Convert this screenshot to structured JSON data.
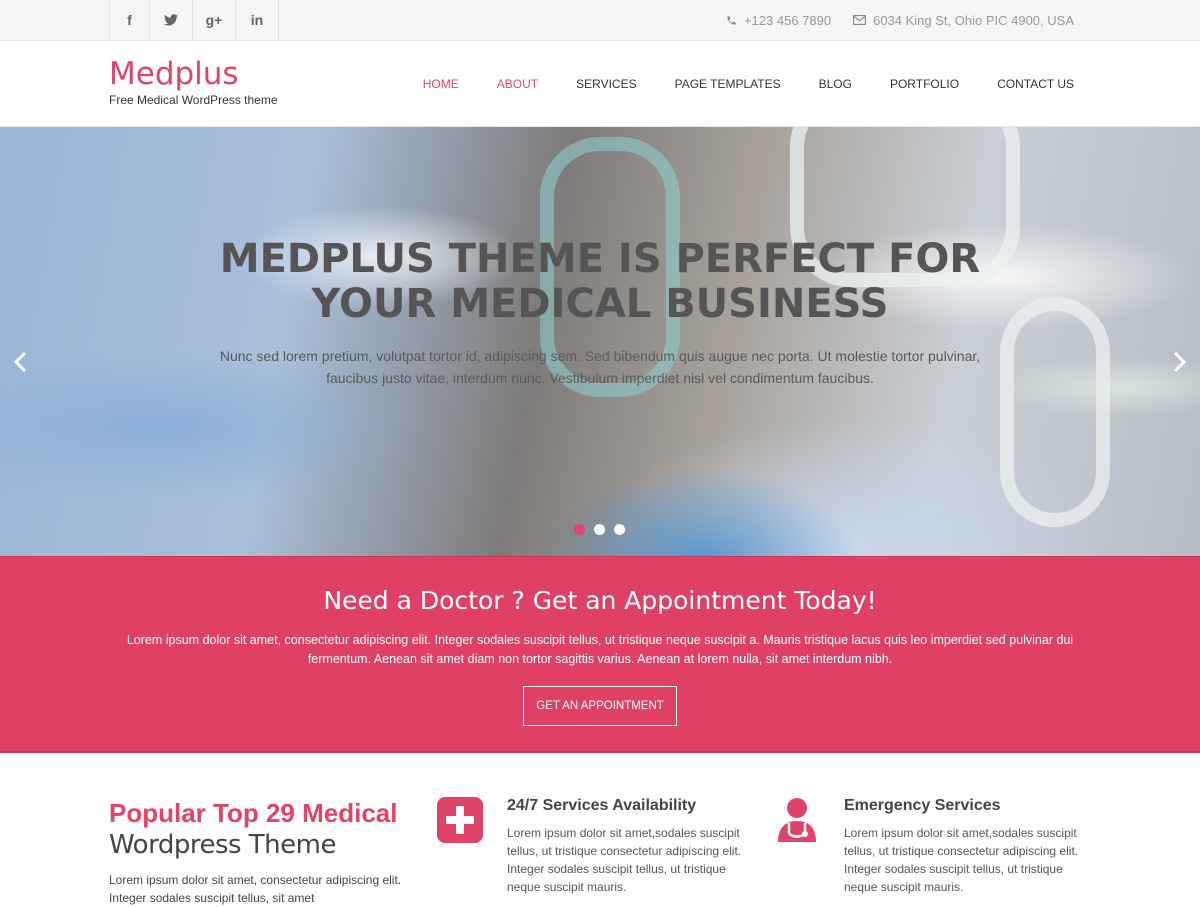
{
  "topbar": {
    "social": [
      {
        "icon": "facebook-icon",
        "glyph": "f"
      },
      {
        "icon": "twitter-icon",
        "glyph": "t"
      },
      {
        "icon": "google-plus-icon",
        "glyph": "g+"
      },
      {
        "icon": "linkedin-icon",
        "glyph": "in"
      }
    ],
    "phone": "+123 456 7890",
    "address": "6034 King St, Ohio PIC 4900, USA"
  },
  "header": {
    "logo_name": "Medplus",
    "logo_tagline": "Free Medical WordPress theme",
    "nav": [
      "HOME",
      "ABOUT",
      "SERVICES",
      "PAGE TEMPLATES",
      "BLOG",
      "PORTFOLIO",
      "CONTACT US"
    ]
  },
  "hero": {
    "title_line1": "MEDPLUS THEME IS PERFECT FOR",
    "title_line2": "YOUR MEDICAL BUSINESS",
    "subtitle": "Nunc sed lorem pretium, volutpat tortor id, adipiscing sem. Sed bibendum quis augue nec porta. Ut molestie tortor pulvinar, faucibus justo vitae, interdum nunc. Vestibulum imperdiet nisl vel condimentum faucibus.",
    "slide_count": 3,
    "active_slide": 1
  },
  "appointment": {
    "heading": "Need a Doctor ? Get an Appointment Today!",
    "text": "Lorem ipsum dolor sit amet, consectetur adipiscing elit. Integer sodales suscipit tellus, ut tristique neque suscipit a. Mauris tristique lacus quis leo imperdiet sed pulvinar dui fermentum. Aenean sit amet diam non tortor sagittis varius. Aenean at lorem nulla, sit amet interdum nibh.",
    "button": "GET AN APPOINTMENT"
  },
  "features": {
    "intro_title_1": "Popular Top 29 Medical",
    "intro_title_2": "Wordpress Theme",
    "intro_text": "Lorem ipsum dolor sit amet, consectetur adipiscing elit. Integer sodales suscipit tellus, sit amet",
    "cards": [
      {
        "icon": "medical-cross-icon",
        "title": "24/7 Services Availability",
        "text": "Lorem ipsum dolor sit amet,sodales suscipit tellus, ut tristique consectetur adipiscing elit. Integer sodales suscipit tellus, ut tristique neque suscipit mauris."
      },
      {
        "icon": "doctor-stethoscope-icon",
        "title": "Emergency Services",
        "text": "Lorem ipsum dolor sit amet,sodales suscipit tellus, ut tristique consectetur adipiscing elit. Integer sodales suscipit tellus, ut tristique neque suscipit mauris."
      }
    ]
  },
  "colors": {
    "accent": "#e0446a",
    "text_dark": "#444444",
    "topbar_bg": "#f5f5f5"
  }
}
